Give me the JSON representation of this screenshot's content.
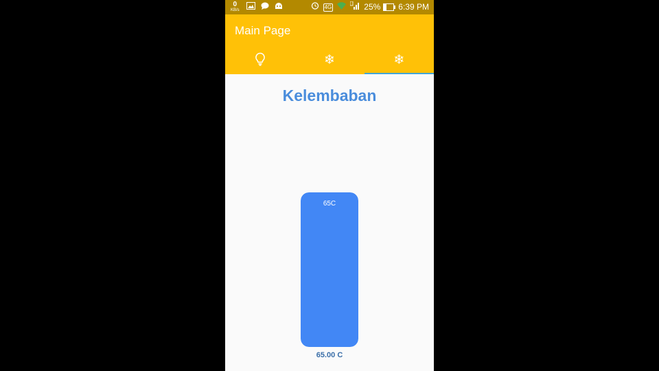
{
  "status_bar": {
    "net_speed_value": "0",
    "net_speed_unit": "KB/s",
    "left_icons": [
      "image-icon",
      "chat-bubble-icon",
      "android-icon"
    ],
    "lte_label": "4G",
    "battery_percent": "25%",
    "battery_level": 0.25,
    "time": "6:39 PM"
  },
  "appbar": {
    "title": "Main Page",
    "background_color": "#ffc107",
    "indicator_color": "#42a5d5",
    "tabs": [
      {
        "icon": "lightbulb-icon",
        "glyph": "💡",
        "selected": false
      },
      {
        "icon": "snowflake-icon",
        "glyph": "❄",
        "selected": false
      },
      {
        "icon": "snowflake-icon",
        "glyph": "❄",
        "selected": true
      }
    ]
  },
  "main": {
    "heading": "Kelembaban",
    "heading_color": "#4a8ddc",
    "gauge": {
      "label": "65C",
      "level": 1.0,
      "color": "#4287f5"
    },
    "reading": "65.00 C"
  }
}
